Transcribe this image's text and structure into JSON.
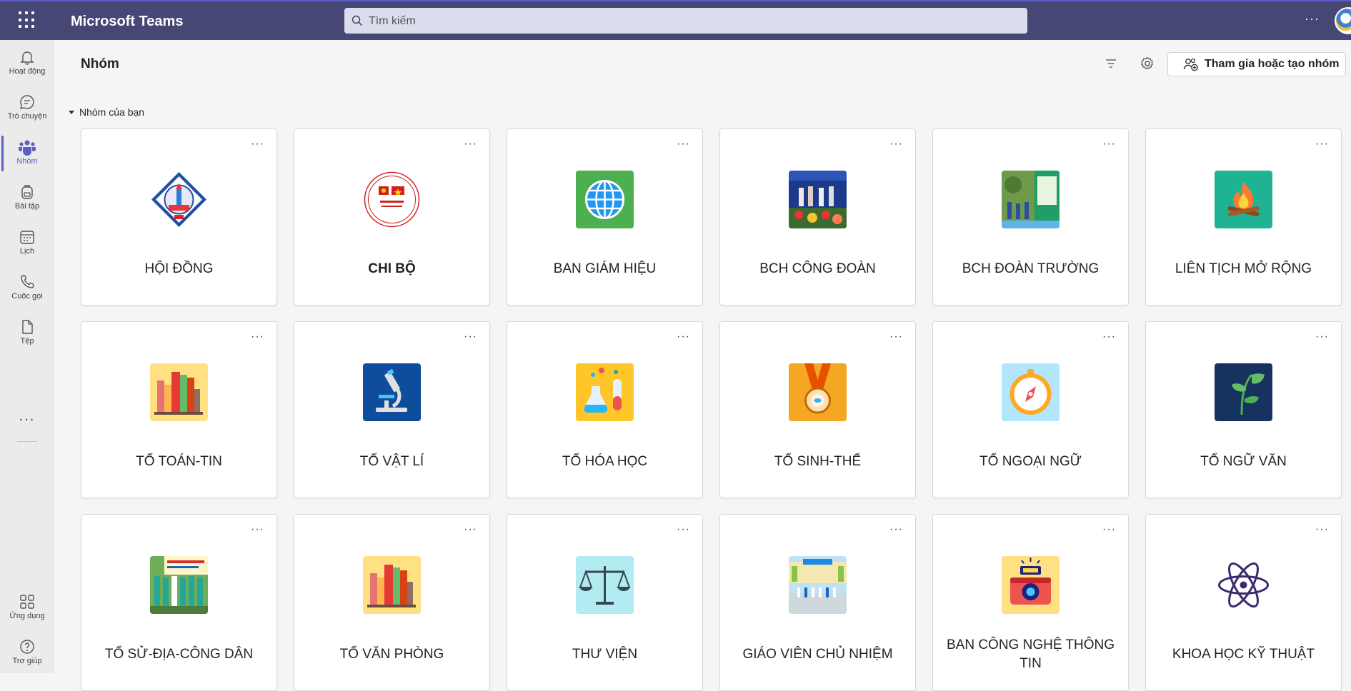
{
  "app": {
    "title": "Microsoft Teams"
  },
  "search": {
    "placeholder": "Tìm kiếm"
  },
  "rail": {
    "items": [
      {
        "label": "Hoạt động",
        "icon": "bell-icon"
      },
      {
        "label": "Trò chuyện",
        "icon": "chat-icon"
      },
      {
        "label": "Nhóm",
        "icon": "teams-icon",
        "active": true
      },
      {
        "label": "Bài tập",
        "icon": "backpack-icon"
      },
      {
        "label": "Lịch",
        "icon": "calendar-icon"
      },
      {
        "label": "Cuộc gọi",
        "icon": "phone-icon"
      },
      {
        "label": "Tệp",
        "icon": "file-icon"
      }
    ],
    "more": "...",
    "apps_label": "Ứng dụng",
    "help_label": "Trợ giúp"
  },
  "header": {
    "title": "Nhóm",
    "join_label": "Tham gia hoặc tạo nhóm"
  },
  "section": {
    "label": "Nhóm của bạn"
  },
  "teams": [
    {
      "name": "HỘI ĐỒNG",
      "icon": "school-emblem-icon"
    },
    {
      "name": "CHI BỘ",
      "icon": "party-emblem-icon",
      "bold": true
    },
    {
      "name": "BAN GIÁM HIỆU",
      "icon": "globe-icon"
    },
    {
      "name": "BCH CÔNG ĐOÀN",
      "icon": "photo-icon"
    },
    {
      "name": "BCH ĐOÀN TRƯỜNG",
      "icon": "photo-icon"
    },
    {
      "name": "LIÊN TỊCH MỞ RỘNG",
      "icon": "campfire-icon"
    },
    {
      "name": "TỔ TOÁN-TIN",
      "icon": "books-icon"
    },
    {
      "name": "TỔ VẬT LÍ",
      "icon": "microscope-icon"
    },
    {
      "name": "TỔ HÓA HỌC",
      "icon": "flask-icon"
    },
    {
      "name": "TỔ SINH-THỂ",
      "icon": "medal-icon"
    },
    {
      "name": "TỔ NGOẠI NGỮ",
      "icon": "compass-icon"
    },
    {
      "name": "TỔ NGỮ VĂN",
      "icon": "plant-icon"
    },
    {
      "name": "TỔ SỬ-ĐỊA-CÔNG DÂN",
      "icon": "photo-icon"
    },
    {
      "name": "TỔ VĂN PHÒNG",
      "icon": "books-icon"
    },
    {
      "name": "THƯ VIỆN",
      "icon": "scales-icon"
    },
    {
      "name": "GIÁO VIÊN CHỦ NHIỆM",
      "icon": "photo-icon"
    },
    {
      "name": "BAN CÔNG NGHỆ THÔNG TIN",
      "icon": "camera-icon"
    },
    {
      "name": "KHOA HỌC KỸ THUẬT",
      "icon": "atom-icon"
    }
  ],
  "colors": {
    "topbar": "#464775",
    "accent": "#5b5fc7"
  }
}
